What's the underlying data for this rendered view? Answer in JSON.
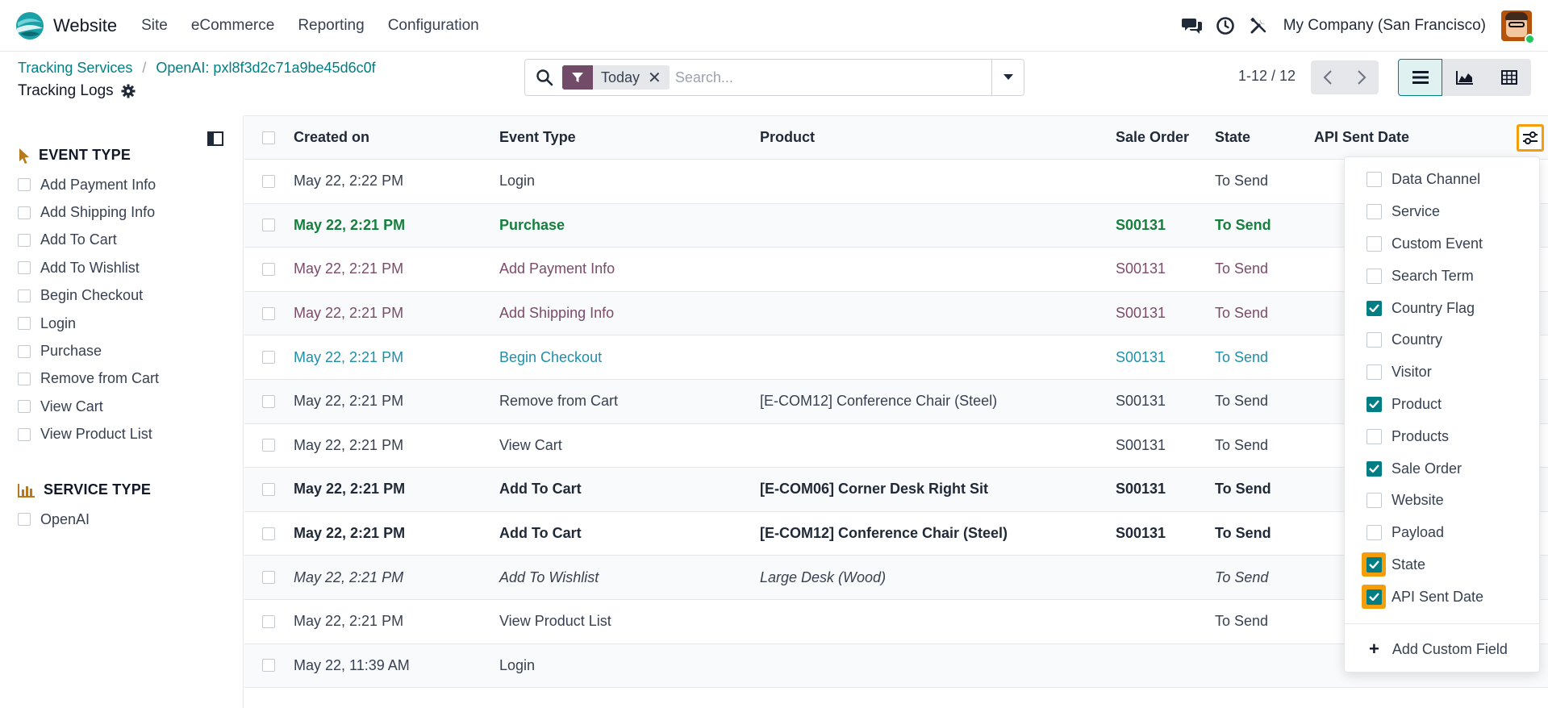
{
  "app": {
    "name": "Website",
    "menu": [
      "Site",
      "eCommerce",
      "Reporting",
      "Configuration"
    ],
    "company": "My Company (San Francisco)"
  },
  "icons": {
    "chat": "chat-icon",
    "activity": "clock-icon",
    "debug": "wrench-icon",
    "search": "search-icon",
    "filter": "funnel-icon",
    "settings": "gear-icon"
  },
  "colors": {
    "accent": "#017e84",
    "brand": "#714b67",
    "highlight": "#f59e0b",
    "success": "#15803d"
  },
  "breadcrumb": {
    "items": [
      "Tracking Services",
      "OpenAI: pxl8f3d2c71a9be45d6c0f"
    ],
    "separator": "/",
    "current": "Tracking Logs"
  },
  "search": {
    "facet": "Today",
    "remove": "✕",
    "placeholder": "Search..."
  },
  "pager": {
    "value": "1-12 / 12"
  },
  "sidepanel": {
    "event_type": {
      "title": "EVENT TYPE",
      "items": [
        "Add Payment Info",
        "Add Shipping Info",
        "Add To Cart",
        "Add To Wishlist",
        "Begin Checkout",
        "Login",
        "Purchase",
        "Remove from Cart",
        "View Cart",
        "View Product List"
      ]
    },
    "service_type": {
      "title": "SERVICE TYPE",
      "items": [
        "OpenAI"
      ]
    }
  },
  "list": {
    "headers": {
      "created": "Created on",
      "event": "Event Type",
      "product": "Product",
      "sale_order": "Sale Order",
      "state": "State",
      "api": "API Sent Date"
    },
    "rows": [
      {
        "created": "May 22, 2:22 PM",
        "event": "Login",
        "product": "",
        "sale_order": "",
        "state": "To Send",
        "style": ""
      },
      {
        "created": "May 22, 2:21 PM",
        "event": "Purchase",
        "product": "",
        "sale_order": "S00131",
        "state": "To Send",
        "style": "success"
      },
      {
        "created": "May 22, 2:21 PM",
        "event": "Add Payment Info",
        "product": "",
        "sale_order": "S00131",
        "state": "To Send",
        "style": "muted"
      },
      {
        "created": "May 22, 2:21 PM",
        "event": "Add Shipping Info",
        "product": "",
        "sale_order": "S00131",
        "state": "To Send",
        "style": "muted"
      },
      {
        "created": "May 22, 2:21 PM",
        "event": "Begin Checkout",
        "product": "",
        "sale_order": "S00131",
        "state": "To Send",
        "style": "info"
      },
      {
        "created": "May 22, 2:21 PM",
        "event": "Remove from Cart",
        "product": "[E-COM12] Conference Chair (Steel)",
        "sale_order": "S00131",
        "state": "To Send",
        "style": ""
      },
      {
        "created": "May 22, 2:21 PM",
        "event": "View Cart",
        "product": "",
        "sale_order": "S00131",
        "state": "To Send",
        "style": ""
      },
      {
        "created": "May 22, 2:21 PM",
        "event": "Add To Cart",
        "product": "[E-COM06] Corner Desk Right Sit",
        "sale_order": "S00131",
        "state": "To Send",
        "style": "bold"
      },
      {
        "created": "May 22, 2:21 PM",
        "event": "Add To Cart",
        "product": "[E-COM12] Conference Chair (Steel)",
        "sale_order": "S00131",
        "state": "To Send",
        "style": "bold"
      },
      {
        "created": "May 22, 2:21 PM",
        "event": "Add To Wishlist",
        "product": "Large Desk (Wood)",
        "sale_order": "",
        "state": "To Send",
        "style": "ital"
      },
      {
        "created": "May 22, 2:21 PM",
        "event": "View Product List",
        "product": "",
        "sale_order": "",
        "state": "To Send",
        "style": ""
      },
      {
        "created": "May 22, 11:39 AM",
        "event": "Login",
        "product": "",
        "sale_order": "",
        "state": "",
        "style": ""
      }
    ]
  },
  "optional_columns": {
    "items": [
      {
        "label": "Data Channel",
        "checked": false,
        "highlight": false
      },
      {
        "label": "Service",
        "checked": false,
        "highlight": false
      },
      {
        "label": "Custom Event",
        "checked": false,
        "highlight": false
      },
      {
        "label": "Search Term",
        "checked": false,
        "highlight": false
      },
      {
        "label": "Country Flag",
        "checked": true,
        "highlight": false
      },
      {
        "label": "Country",
        "checked": false,
        "highlight": false
      },
      {
        "label": "Visitor",
        "checked": false,
        "highlight": false
      },
      {
        "label": "Product",
        "checked": true,
        "highlight": false
      },
      {
        "label": "Products",
        "checked": false,
        "highlight": false
      },
      {
        "label": "Sale Order",
        "checked": true,
        "highlight": false
      },
      {
        "label": "Website",
        "checked": false,
        "highlight": false
      },
      {
        "label": "Payload",
        "checked": false,
        "highlight": false
      },
      {
        "label": "State",
        "checked": true,
        "highlight": true
      },
      {
        "label": "API Sent Date",
        "checked": true,
        "highlight": true
      }
    ],
    "add_custom": "Add Custom Field"
  }
}
